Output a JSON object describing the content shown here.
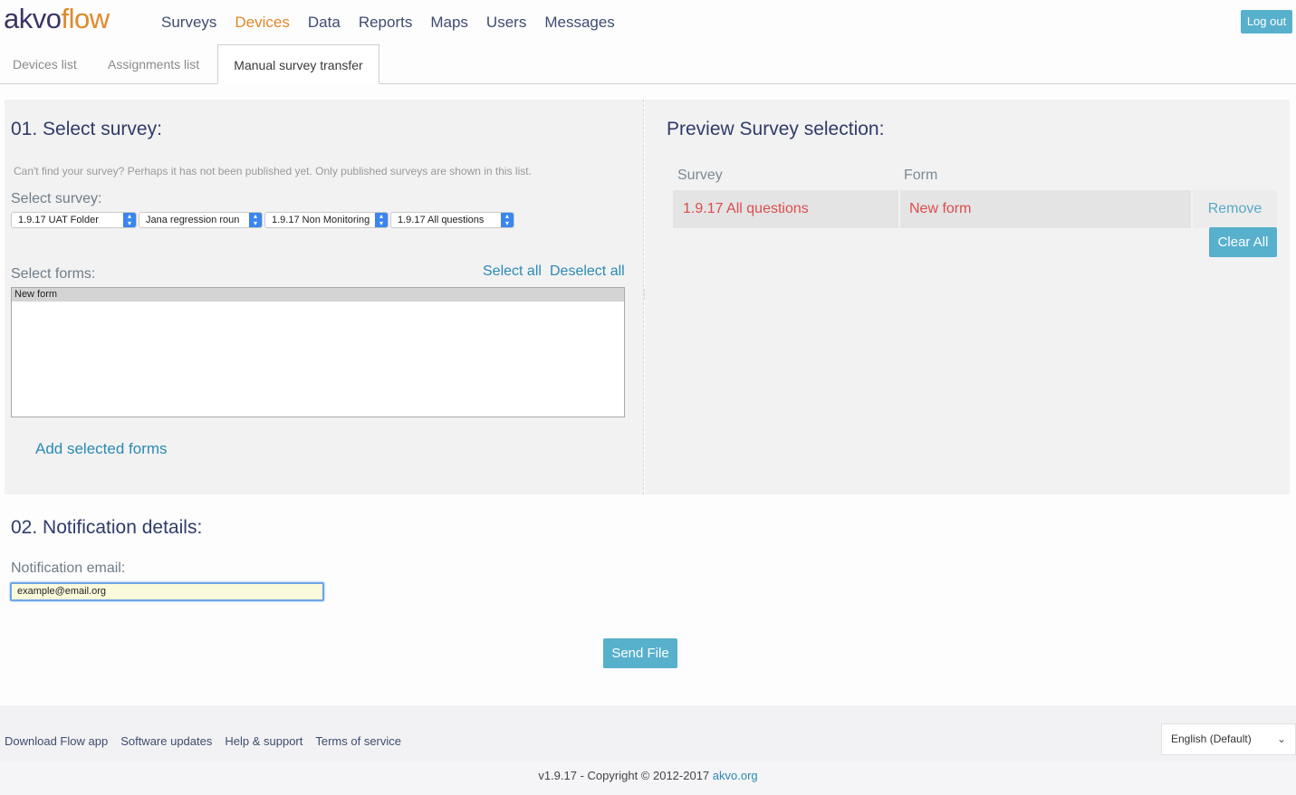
{
  "brand": {
    "part1": "akvo",
    "part2": "flow"
  },
  "nav": {
    "items": [
      "Surveys",
      "Devices",
      "Data",
      "Reports",
      "Maps",
      "Users",
      "Messages"
    ],
    "active": "Devices"
  },
  "header": {
    "logout": "Log out"
  },
  "tabs": {
    "devices_list": "Devices list",
    "assignments_list": "Assignments list",
    "manual_transfer": "Manual survey transfer"
  },
  "select_survey": {
    "heading": "01. Select survey:",
    "note": "Can't find your survey? Perhaps it has not been published yet. Only published surveys are shown in this list.",
    "label": "Select survey:",
    "dropdowns": [
      "1.9.17 UAT Folder",
      "Jana regression roun",
      "1.9.17 Non Monitoring",
      "1.9.17 All questions"
    ],
    "forms_label": "Select forms:",
    "select_all": "Select all",
    "deselect_all": "Deselect all",
    "forms": [
      "New form"
    ],
    "add_selected": "Add selected forms"
  },
  "preview": {
    "heading": "Preview Survey selection:",
    "col_survey": "Survey",
    "col_form": "Form",
    "rows": [
      {
        "survey": "1.9.17 All questions",
        "form": "New form",
        "action": "Remove"
      }
    ],
    "clear_all": "Clear All"
  },
  "notification": {
    "heading": "02. Notification details:",
    "email_label": "Notification email:",
    "email_value": "example@email.org"
  },
  "send_file": "Send File",
  "footer": {
    "links": [
      "Download Flow app",
      "Software updates",
      "Help & support",
      "Terms of service"
    ],
    "language": "English (Default)",
    "copyright": "v1.9.17 - Copyright © 2012-2017",
    "copyright_link": "akvo.org"
  },
  "colors": {
    "accent": "#57b0cc",
    "brand_orange": "#e0892a",
    "brand_navy": "#3b3567",
    "preview_text": "#dc4c4c",
    "link": "#2b8ab3"
  }
}
